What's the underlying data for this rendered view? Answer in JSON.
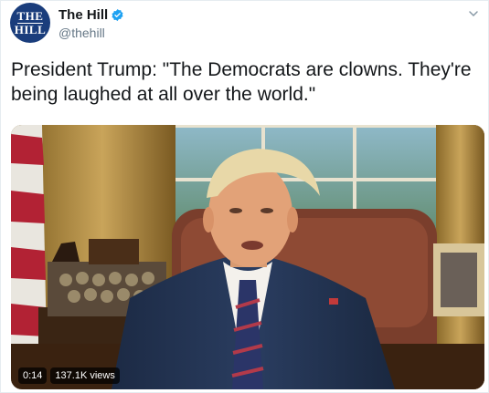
{
  "account": {
    "avatar_text": [
      "THE",
      "HILL"
    ],
    "display_name": "The Hill",
    "handle": "@thehill",
    "verified_icon": "verified-badge-icon",
    "brand_color": "#1da1f2"
  },
  "tweet": {
    "text": "President Trump: \"The Democrats are clowns. They're being laughed at all over the world.\""
  },
  "media": {
    "type": "video",
    "time": "0:14",
    "views": "137.1K views"
  },
  "menu_icon": "chevron-down-icon"
}
